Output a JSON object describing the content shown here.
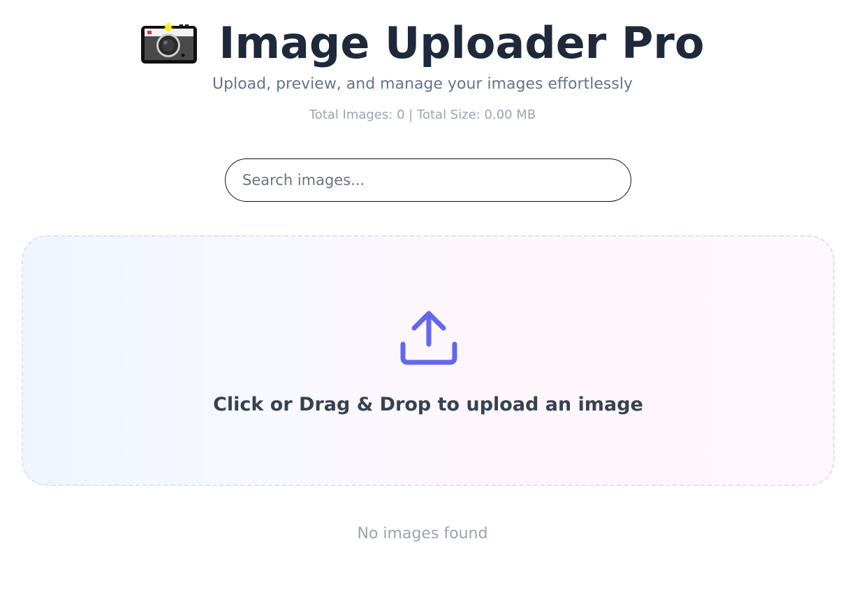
{
  "header": {
    "icon": "camera-icon",
    "title": "Image Uploader Pro",
    "subtitle": "Upload, preview, and manage your images effortlessly"
  },
  "stats": {
    "text": "Total Images: 0 | Total Size: 0.00 MB"
  },
  "search": {
    "placeholder": "Search images...",
    "value": ""
  },
  "dropzone": {
    "icon": "upload-icon",
    "label": "Click or Drag & Drop to upload an image"
  },
  "gallery": {
    "empty_message": "No images found"
  },
  "colors": {
    "title": "#1e293b",
    "accent": "#6366f1",
    "muted": "#9ca3af",
    "subtitle": "#64748b"
  }
}
